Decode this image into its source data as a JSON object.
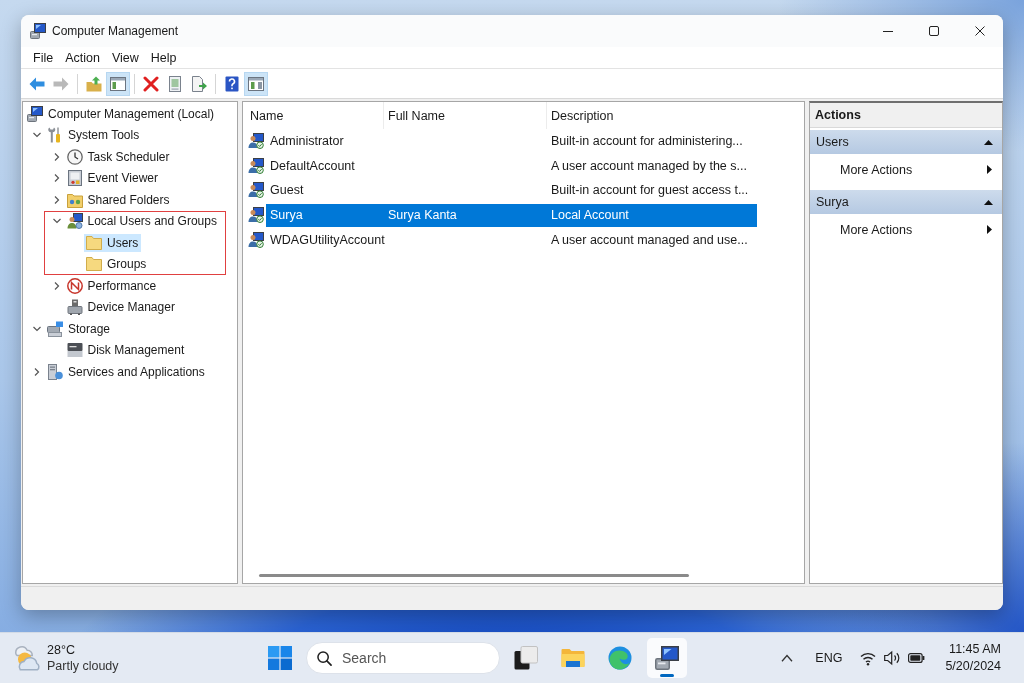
{
  "window": {
    "title": "Computer Management"
  },
  "menu": [
    "File",
    "Action",
    "View",
    "Help"
  ],
  "toolbar": [
    [
      {
        "pressed": false,
        "disabled": false
      },
      {
        "pressed": false,
        "disabled": true
      }
    ],
    [
      {
        "pressed": false,
        "disabled": false
      },
      {
        "pressed": true,
        "disabled": false
      }
    ],
    [
      {
        "pressed": false,
        "disabled": false
      },
      {
        "pressed": false,
        "disabled": false
      },
      {
        "pressed": false,
        "disabled": false
      }
    ],
    [
      {
        "pressed": false,
        "disabled": false
      },
      {
        "pressed": true,
        "disabled": false
      }
    ]
  ],
  "tree": [
    {
      "label": "Computer Management (Local)",
      "selected": false,
      "children": [
        {
          "label": "System Tools",
          "expanded": true,
          "selected": false,
          "children": [
            {
              "label": "Task Scheduler",
              "expanded": false,
              "selected": false
            },
            {
              "label": "Event Viewer",
              "expanded": false,
              "selected": false
            },
            {
              "label": "Shared Folders",
              "expanded": false,
              "selected": false
            },
            {
              "label": "Local Users and Groups",
              "expanded": true,
              "selected": false,
              "annotated": true,
              "children": [
                {
                  "label": "Users",
                  "selected": true
                },
                {
                  "label": "Groups",
                  "selected": false
                }
              ]
            },
            {
              "label": "Performance",
              "expanded": false,
              "selected": false
            },
            {
              "label": "Device Manager",
              "selected": false
            }
          ]
        },
        {
          "label": "Storage",
          "expanded": true,
          "selected": false,
          "children": [
            {
              "label": "Disk Management",
              "selected": false
            }
          ]
        },
        {
          "label": "Services and Applications",
          "expanded": false,
          "selected": false
        }
      ]
    }
  ],
  "list": {
    "columns": [
      "Name",
      "Full Name",
      "Description"
    ],
    "rows": [
      {
        "name": "Administrator",
        "description": "Built-in account for administering...",
        "selected": false
      },
      {
        "name": "DefaultAccount",
        "description": "A user account managed by the s...",
        "selected": false
      },
      {
        "name": "Guest",
        "description": "Built-in account for guest access t...",
        "selected": false
      },
      {
        "name": "Surya",
        "full_name": "Surya Kanta",
        "description": "Local Account",
        "selected": true
      },
      {
        "name": "WDAGUtilityAccount",
        "description": "A user account managed and use...",
        "selected": false
      }
    ]
  },
  "actions": {
    "title": "Actions",
    "sections": [
      {
        "title": "Users",
        "expanded": true,
        "items": [
          "More Actions"
        ]
      },
      {
        "title": "Surya",
        "expanded": true,
        "items": [
          "More Actions"
        ]
      }
    ]
  },
  "taskbar": {
    "weather": {
      "temperature": "28°C",
      "condition": "Partly cloudy"
    },
    "search": {
      "placeholder": "Search"
    },
    "apps": [
      {
        "active": false
      },
      {
        "active": false
      },
      {
        "active": false
      },
      {
        "active": true
      }
    ],
    "language": "ENG",
    "clock": {
      "time": "11:45 AM",
      "date": "5/20/2024"
    }
  }
}
